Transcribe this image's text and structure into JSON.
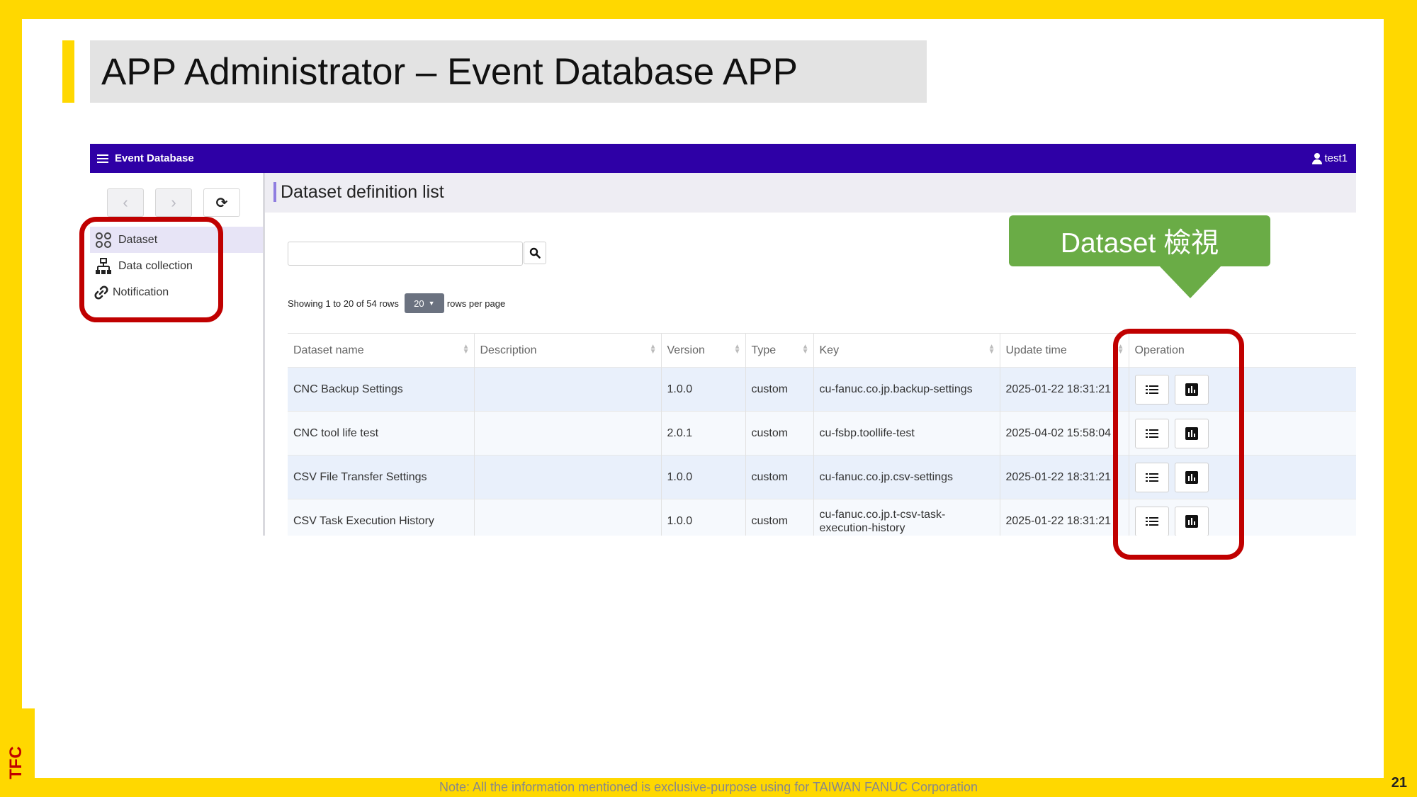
{
  "slide": {
    "title": "APP Administrator – Event Database APP",
    "footer_note": "Note: All the information mentioned is exclusive-purpose using for TAIWAN FANUC Corporation",
    "page_number": "21",
    "logo_text": "TFC",
    "callout_text": "Dataset 檢視",
    "colors": {
      "frame": "#FFD800",
      "title_bg": "#E3E3E3",
      "callout": "#6AAC46",
      "highlight": "#C00000"
    }
  },
  "app": {
    "brand": "Event Database",
    "user": "test1",
    "colors": {
      "topbar": "#2E00A6",
      "accent": "#8F7DE0"
    },
    "nav": {
      "back_icon": "chevron-left-icon",
      "forward_icon": "chevron-right-icon",
      "refresh_icon": "refresh-icon"
    },
    "menu": [
      {
        "label": "Dataset",
        "icon": "dataset-grid-icon",
        "active": true
      },
      {
        "label": "Data collection",
        "icon": "hierarchy-icon",
        "active": false
      },
      {
        "label": "Notification",
        "icon": "link-icon",
        "active": false
      }
    ],
    "content": {
      "title": "Dataset definition list",
      "search": {
        "value": "",
        "placeholder": ""
      },
      "paging": {
        "showing": "Showing 1 to 20 of 54 rows",
        "per_page": "20",
        "per_page_suffix": "rows per page"
      },
      "columns": [
        "Dataset name",
        "Description",
        "Version",
        "Type",
        "Key",
        "Update time",
        "Operation"
      ],
      "rows": [
        {
          "name": "CNC Backup Settings",
          "description": "",
          "version": "1.0.0",
          "type": "custom",
          "key": "cu-fanuc.co.jp.backup-settings",
          "updated": "2025-01-22 18:31:21"
        },
        {
          "name": "CNC tool life test",
          "description": "",
          "version": "2.0.1",
          "type": "custom",
          "key": "cu-fsbp.toollife-test",
          "updated": "2025-04-02 15:58:04"
        },
        {
          "name": "CSV File Transfer Settings",
          "description": "",
          "version": "1.0.0",
          "type": "custom",
          "key": "cu-fanuc.co.jp.csv-settings",
          "updated": "2025-01-22 18:31:21"
        },
        {
          "name": "CSV Task Execution History",
          "description": "",
          "version": "1.0.0",
          "type": "custom",
          "key": "cu-fanuc.co.jp.t-csv-task-execution-history",
          "updated": "2025-01-22 18:31:21"
        }
      ],
      "operations": [
        {
          "icon": "list-icon"
        },
        {
          "icon": "bar-chart-icon"
        }
      ]
    }
  }
}
